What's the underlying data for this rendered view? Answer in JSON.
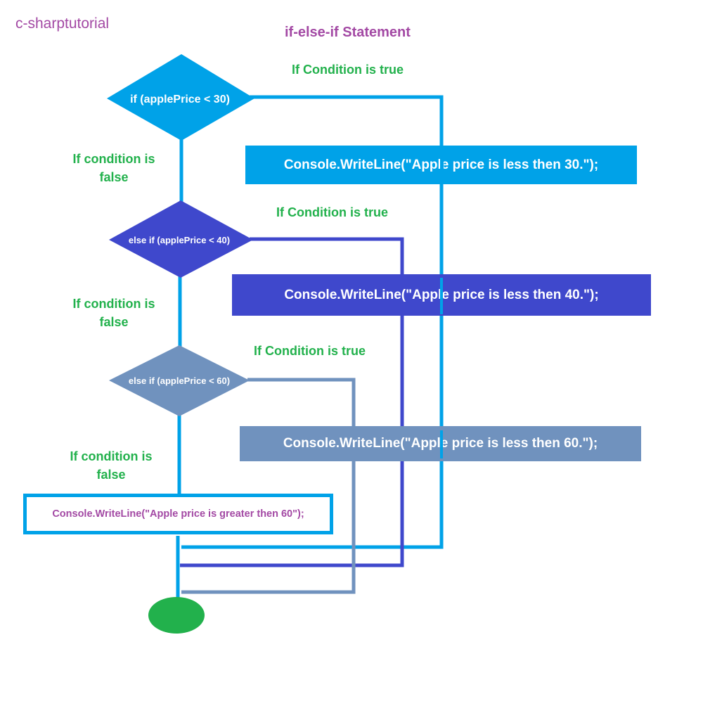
{
  "header": {
    "brand": "c-sharptutorial",
    "title": "if-else-if Statement"
  },
  "colors": {
    "level1": "#00A2E8",
    "level2": "#3F48CC",
    "level3": "#7092BE",
    "label_green": "#22B14C",
    "title_purple": "#A349A4",
    "end_node": "#22B14C"
  },
  "nodes": {
    "condition1": "if (applePrice < 30)",
    "condition2": "else if (applePrice < 40)",
    "condition3": "else if (applePrice < 60)",
    "action1": "Console.WriteLine(\"Apple price is less then 30.\");",
    "action2": "Console.WriteLine(\"Apple price is less then 40.\");",
    "action3": "Console.WriteLine(\"Apple price is less then 60.\");",
    "else_action": "Console.WriteLine(\"Apple price is greater then 60\");"
  },
  "labels": {
    "true1": "If Condition is true",
    "true2": "If Condition is true",
    "true3": "If Condition is true",
    "false1_line1": "If condition is",
    "false1_line2": "false",
    "false2_line1": "If condition is",
    "false2_line2": "false",
    "false3_line1": "If condition is",
    "false3_line2": "false"
  }
}
